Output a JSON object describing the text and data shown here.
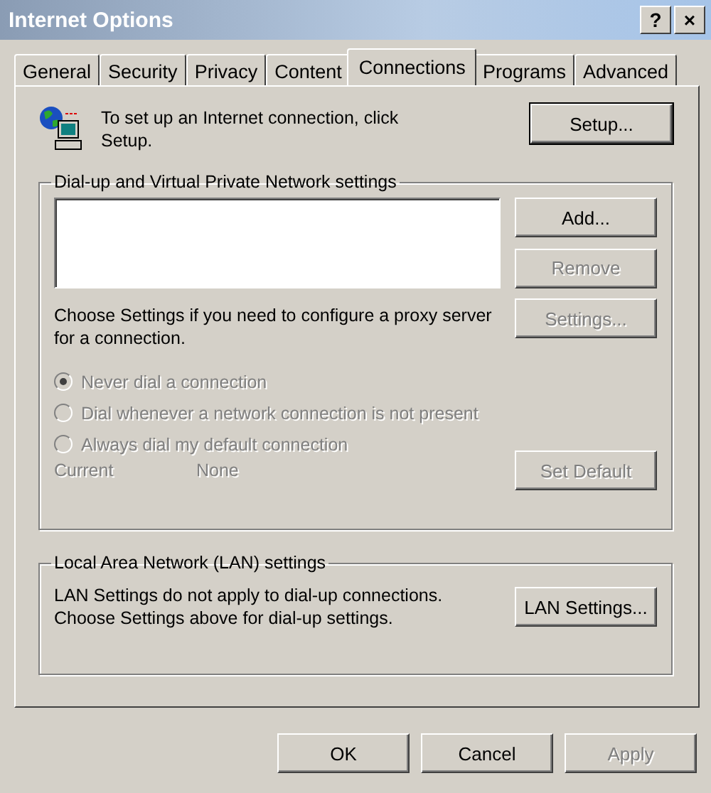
{
  "window": {
    "title": "Internet Options",
    "title_buttons": [
      "?",
      "×"
    ]
  },
  "tabs": [
    {
      "label": "General",
      "selected": false
    },
    {
      "label": "Security",
      "selected": false
    },
    {
      "label": "Privacy",
      "selected": false
    },
    {
      "label": "Content",
      "selected": false
    },
    {
      "label": "Connections",
      "selected": true
    },
    {
      "label": "Programs",
      "selected": false
    },
    {
      "label": "Advanced",
      "selected": false
    }
  ],
  "setup": {
    "text": "To set up an Internet connection, click Setup.",
    "button": {
      "label": "Setup...",
      "disabled": false
    }
  },
  "dialup": {
    "title": "Dial-up and Virtual Private Network settings",
    "buttons": [
      {
        "label": "Add...",
        "disabled": false
      },
      {
        "label": "Remove",
        "disabled": true
      }
    ],
    "proxy_text": "Choose Settings if you need to configure a proxy server for a connection.",
    "settings_button": {
      "label": "Settings...",
      "disabled": true
    },
    "radios": [
      {
        "label": "Never dial a connection",
        "selected": true,
        "disabled": true
      },
      {
        "label": "Dial whenever a network connection is not present",
        "selected": false,
        "disabled": true
      },
      {
        "label": "Always dial my default connection",
        "selected": false,
        "disabled": true
      }
    ],
    "current_label": "Current",
    "current_value": "None",
    "current_disabled": true,
    "set_default_button": {
      "label": "Set Default",
      "disabled": true
    }
  },
  "lan": {
    "title": "Local Area Network (LAN) settings",
    "text": "LAN Settings do not apply to dial-up connections. Choose Settings above for dial-up settings.",
    "button": {
      "label": "LAN Settings...",
      "disabled": false
    }
  },
  "footer_buttons": [
    {
      "label": "OK",
      "disabled": false
    },
    {
      "label": "Cancel",
      "disabled": false
    },
    {
      "label": "Apply",
      "disabled": true
    }
  ]
}
